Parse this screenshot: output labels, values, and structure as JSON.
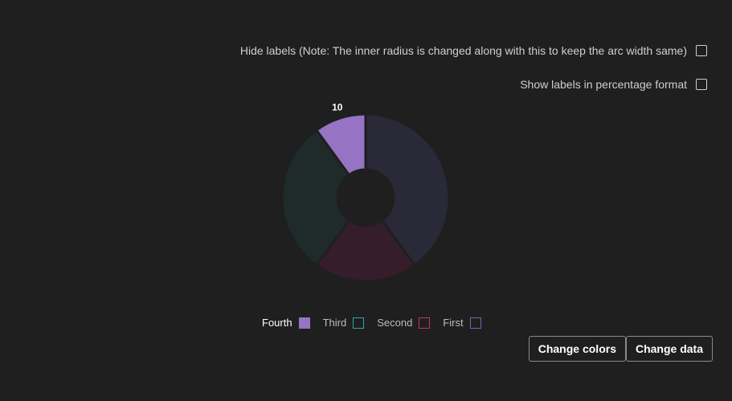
{
  "options": {
    "hide_labels": "Hide labels (Note: The inner radius is changed along with this to keep the arc width same)",
    "percent_labels": "Show labels in percentage format"
  },
  "buttons": {
    "change_colors": "Change colors",
    "change_data": "Change data"
  },
  "chart_data": {
    "type": "pie",
    "categories": [
      "First",
      "Second",
      "Third",
      "Fourth"
    ],
    "values": [
      40,
      20,
      30,
      10
    ],
    "visible_labels": [
      "",
      "",
      "",
      "10"
    ],
    "fill_colors": [
      "#292938",
      "#361d2b",
      "#1f2b2b",
      "#9673c3"
    ],
    "legend_border_colors": [
      "#6b6baa",
      "#c2306e",
      "#2fa8a8",
      "#9673c3"
    ],
    "legend_order": [
      "Fourth",
      "Third",
      "Second",
      "First"
    ],
    "highlighted": "Fourth",
    "legend_placement": "bottom"
  }
}
